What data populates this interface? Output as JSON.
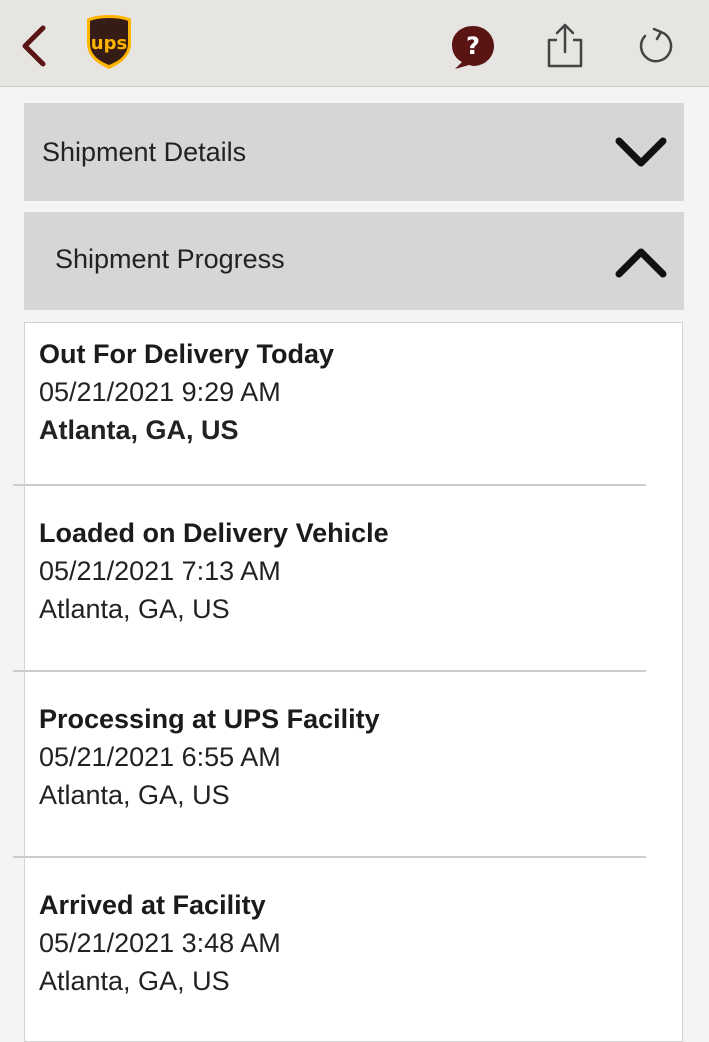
{
  "header": {
    "back_icon": "chevron-left-icon",
    "logo_text": "ups",
    "help_icon": "question-bubble-icon",
    "share_icon": "share-icon",
    "refresh_icon": "refresh-icon",
    "accent_color": "#5a1414",
    "logo_brown": "#351c15",
    "logo_gold": "#ffb500"
  },
  "sections": {
    "details": {
      "label": "Shipment Details",
      "state": "collapsed"
    },
    "progress": {
      "label": "Shipment Progress",
      "state": "expanded"
    }
  },
  "events": [
    {
      "status": "Out For Delivery Today",
      "datetime": "05/21/2021 9:29 AM",
      "location": "Atlanta, GA, US"
    },
    {
      "status": "Loaded on Delivery Vehicle",
      "datetime": "05/21/2021 7:13 AM",
      "location": "Atlanta, GA, US"
    },
    {
      "status": "Processing at UPS Facility",
      "datetime": "05/21/2021 6:55 AM",
      "location": "Atlanta, GA, US"
    },
    {
      "status": "Arrived at Facility",
      "datetime": "05/21/2021 3:48 AM",
      "location": "Atlanta, GA, US"
    }
  ]
}
